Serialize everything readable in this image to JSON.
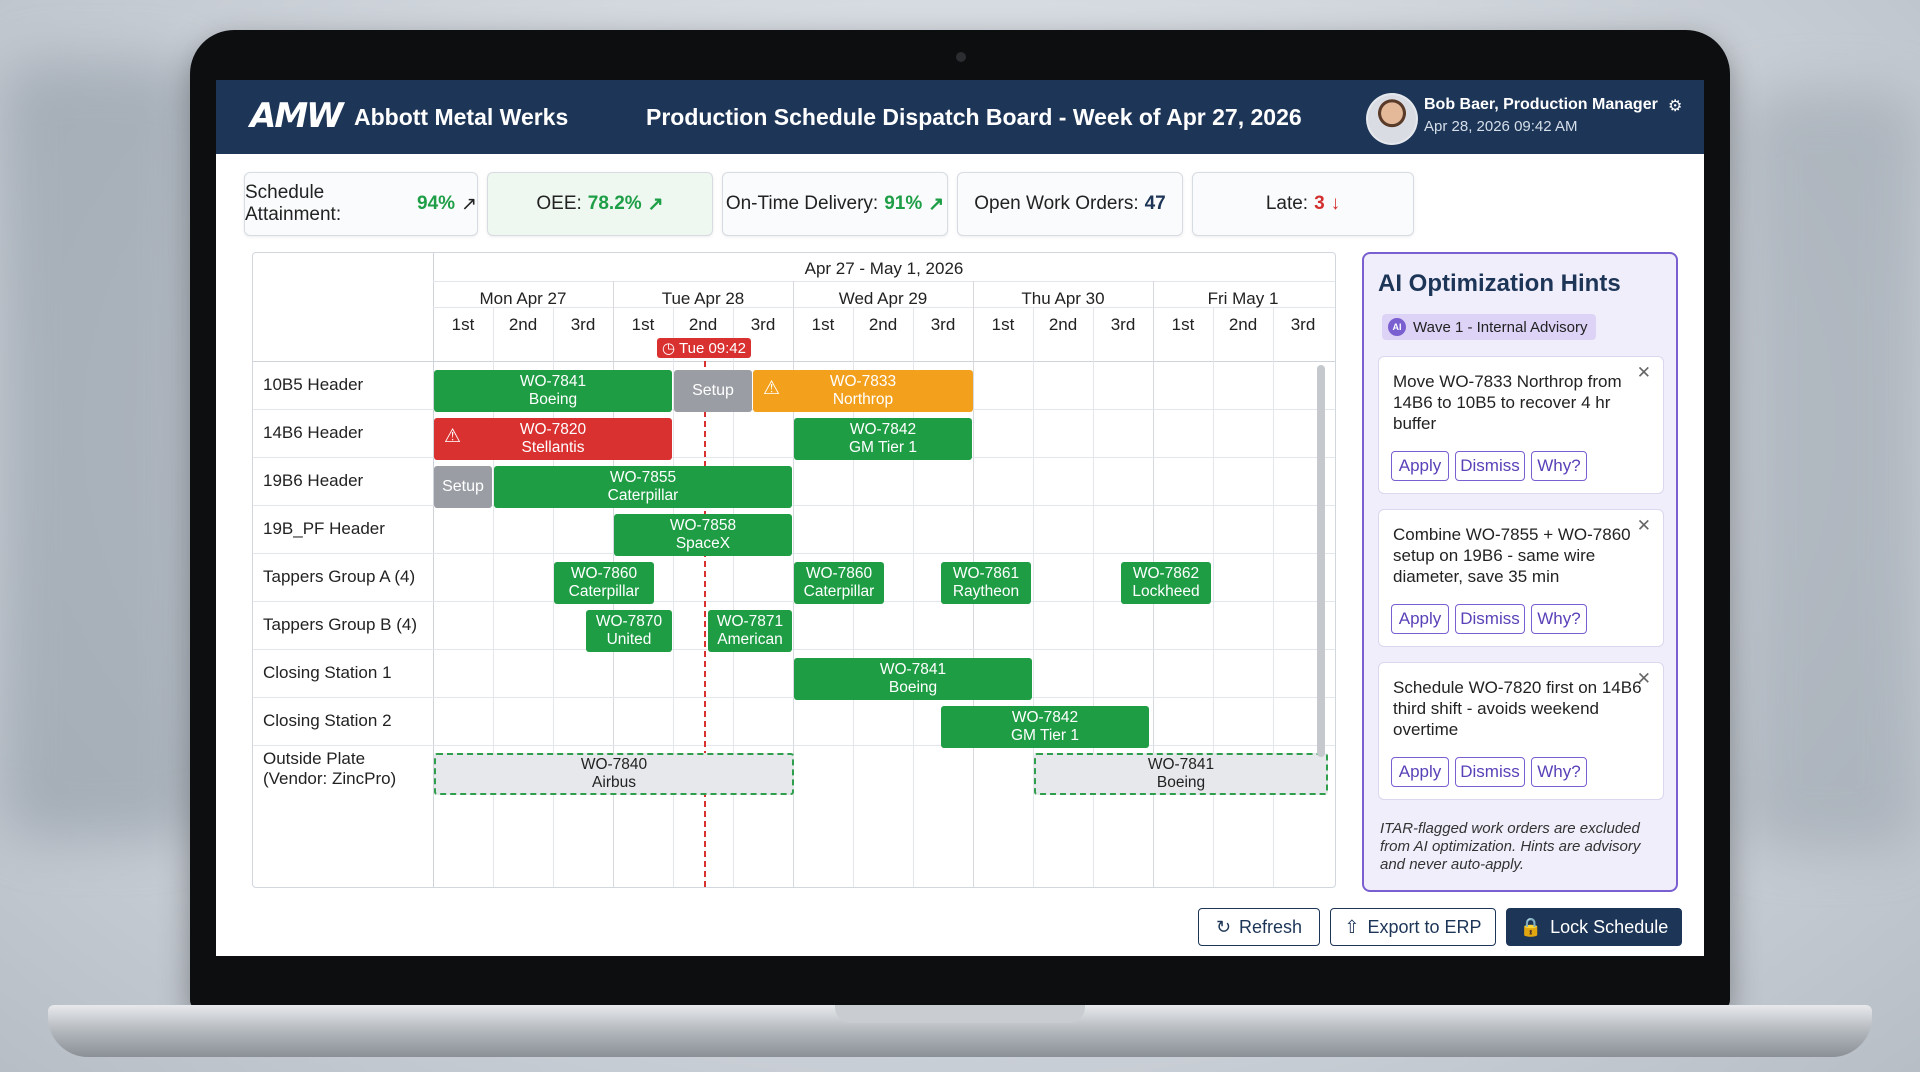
{
  "app": {
    "logo": "AMW",
    "company": "Abbott Metal Werks",
    "title": "Production Schedule Dispatch Board - Week of Apr 27, 2026"
  },
  "user": {
    "name": "Bob Baer, Production Manager",
    "timestamp": "Apr 28, 2026 09:42 AM"
  },
  "kpis": [
    {
      "label": "Schedule Attainment:",
      "value": "94%",
      "trend": "↗"
    },
    {
      "label": "OEE:",
      "value": "78.2%",
      "trend": "↗"
    },
    {
      "label": "On-Time Delivery:",
      "value": "91%",
      "trend": "↗"
    },
    {
      "label": "Open Work Orders:",
      "value": "47",
      "trend": ""
    },
    {
      "label": "Late:",
      "value": "3",
      "trend": "↓"
    }
  ],
  "gantt": {
    "week_label": "Apr 27 - May 1, 2026",
    "days": [
      "Mon Apr 27",
      "Tue Apr 28",
      "Wed Apr 29",
      "Thu Apr 30",
      "Fri May 1"
    ],
    "shifts": [
      "1st",
      "2nd",
      "3rd"
    ],
    "now_label": "Tue 09:42",
    "rows": [
      {
        "label": "10B5 Header"
      },
      {
        "label": "14B6 Header"
      },
      {
        "label": "19B6 Header"
      },
      {
        "label": "19B_PF Header"
      },
      {
        "label": "Tappers Group A (4)"
      },
      {
        "label": "Tappers Group B (4)"
      },
      {
        "label": "Closing Station 1"
      },
      {
        "label": "Closing Station 2"
      },
      {
        "label": "Outside Plate\n(Vendor: ZincPro)"
      }
    ],
    "setup_label": "Setup",
    "bars": [
      {
        "wo": "WO-7841",
        "customer": "Boeing"
      },
      {
        "wo": "WO-7833",
        "customer": "Northrop"
      },
      {
        "wo": "WO-7820",
        "customer": "Stellantis"
      },
      {
        "wo": "WO-7842",
        "customer": "GM Tier 1"
      },
      {
        "wo": "WO-7855",
        "customer": "Caterpillar"
      },
      {
        "wo": "WO-7858",
        "customer": "SpaceX"
      },
      {
        "wo": "WO-7860",
        "customer": "Caterpillar"
      },
      {
        "wo": "WO-7860",
        "customer": "Caterpillar"
      },
      {
        "wo": "WO-7861",
        "customer": "Raytheon"
      },
      {
        "wo": "WO-7862",
        "customer": "Lockheed"
      },
      {
        "wo": "WO-7870",
        "customer": "United"
      },
      {
        "wo": "WO-7871",
        "customer": "American"
      },
      {
        "wo": "WO-7841",
        "customer": "Boeing"
      },
      {
        "wo": "WO-7842",
        "customer": "GM Tier 1"
      },
      {
        "wo": "WO-7840",
        "customer": "Airbus"
      },
      {
        "wo": "WO-7841",
        "customer": "Boeing"
      }
    ]
  },
  "ai": {
    "title": "AI Optimization Hints",
    "badge_icon": "AI",
    "badge": "Wave 1 - Internal Advisory",
    "hints": [
      {
        "text": "Move WO-7833 Northrop from 14B6 to 10B5 to recover 4 hr buffer"
      },
      {
        "text": "Combine WO-7855 + WO-7860 setup on 19B6 - same wire diameter, save 35 min"
      },
      {
        "text": "Schedule WO-7820 first on 14B6 third shift - avoids weekend overtime"
      }
    ],
    "buttons": {
      "apply": "Apply",
      "dismiss": "Dismiss",
      "why": "Why?"
    },
    "note": "ITAR-flagged work orders are excluded from AI optimization. Hints are advisory and never auto-apply."
  },
  "actions": {
    "refresh": "Refresh",
    "export": "Export to ERP",
    "lock": "Lock Schedule"
  },
  "colors": {
    "header": "#1d3557",
    "on_track": "#1f9d45",
    "late": "#d93030",
    "at_risk": "#f3a11d",
    "setup": "#9a9ea4",
    "ai_accent": "#7a5fd0"
  }
}
